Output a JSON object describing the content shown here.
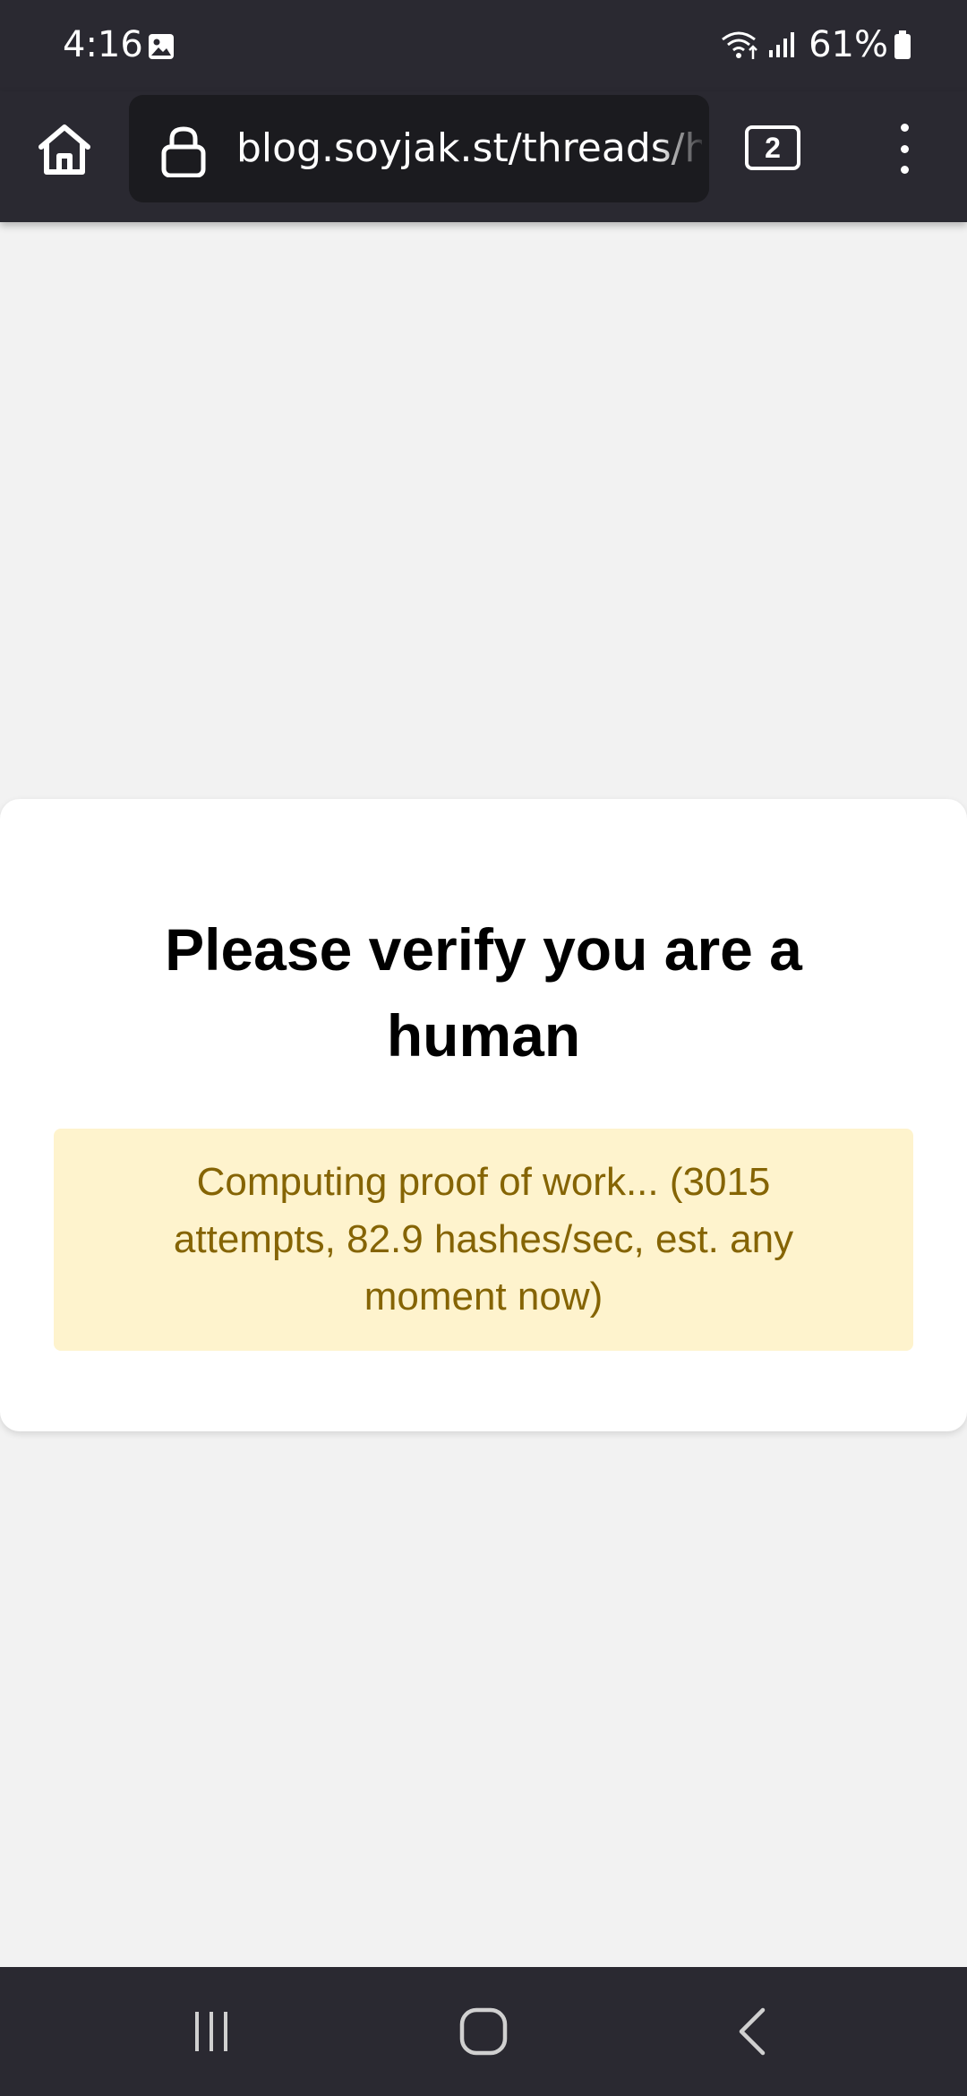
{
  "status_bar": {
    "time": "4:16",
    "battery": "61%",
    "icons": [
      "photo-icon",
      "wifi-icon",
      "signal-icon",
      "battery-icon"
    ]
  },
  "browser": {
    "url": "blog.soyjak.st/threads/how",
    "tab_count": "2",
    "icons": [
      "home-icon",
      "lock-icon",
      "tabs-icon",
      "more-vert-icon"
    ]
  },
  "page": {
    "title": "Please verify you are a human",
    "status_message": "Computing proof of work... (3015 attempts, 82.9 hashes/sec, est. any moment now)"
  },
  "nav_bar": {
    "icons": [
      "recent-apps-icon",
      "home-nav-icon",
      "back-icon"
    ]
  },
  "colors": {
    "chrome": "#2a2931",
    "url_field": "#1b1b1f",
    "background": "#f2f2f2",
    "card": "#ffffff",
    "status_box_bg": "#fef3cd",
    "status_box_text": "#856404"
  }
}
